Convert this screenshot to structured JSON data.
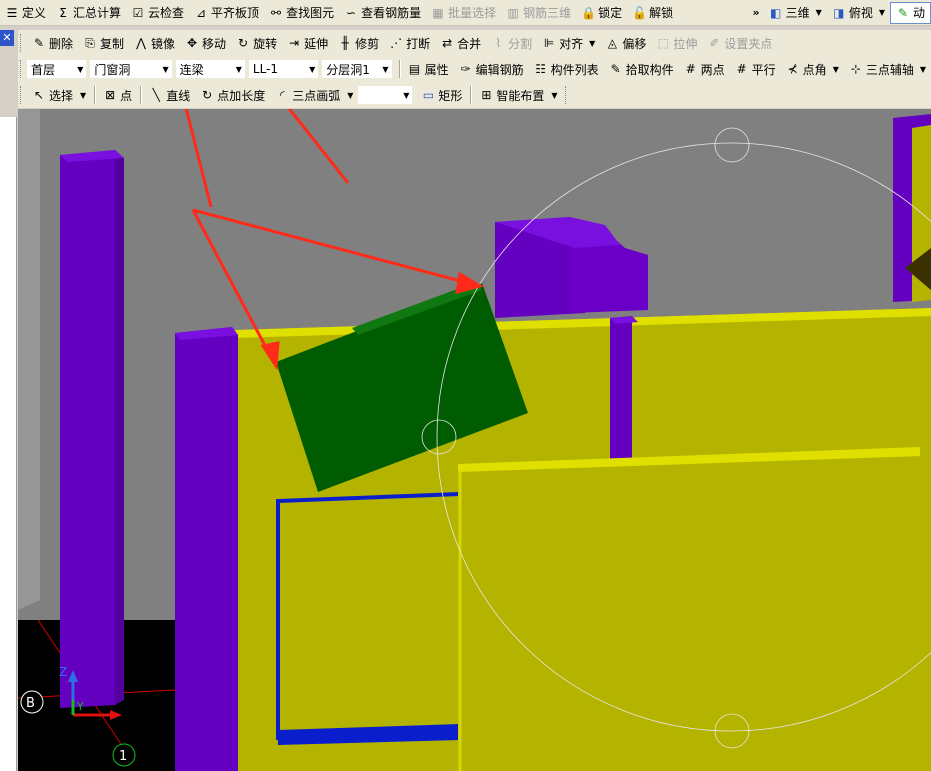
{
  "toolbar_main": {
    "items": [
      {
        "label": "定义",
        "icon": "define-icon"
      },
      {
        "label": "汇总计算",
        "icon": "sigma-icon"
      },
      {
        "label": "云检查",
        "icon": "cloud-check-icon"
      },
      {
        "label": "平齐板顶",
        "icon": "align-slab-icon"
      },
      {
        "label": "查找图元",
        "icon": "binoculars-icon"
      },
      {
        "label": "查看钢筋量",
        "icon": "rebar-qty-icon"
      },
      {
        "label": "批量选择",
        "icon": "batch-select-icon",
        "disabled": true
      },
      {
        "label": "钢筋三维",
        "icon": "rebar-3d-icon",
        "disabled": true
      },
      {
        "label": "锁定",
        "icon": "lock-icon"
      },
      {
        "label": "解锁",
        "icon": "unlock-icon"
      }
    ],
    "overflow": "»",
    "view_3d": "三维",
    "view_top": "俯视",
    "dynamic": "动"
  },
  "toolbar_edit": {
    "items": [
      {
        "label": "删除",
        "icon": "delete-icon"
      },
      {
        "label": "复制",
        "icon": "copy-icon"
      },
      {
        "label": "镜像",
        "icon": "mirror-icon"
      },
      {
        "label": "移动",
        "icon": "move-icon"
      },
      {
        "label": "旋转",
        "icon": "rotate-icon"
      },
      {
        "label": "延伸",
        "icon": "extend-icon"
      },
      {
        "label": "修剪",
        "icon": "trim-icon"
      },
      {
        "label": "打断",
        "icon": "break-icon"
      },
      {
        "label": "合并",
        "icon": "merge-icon"
      },
      {
        "label": "分割",
        "icon": "split-icon",
        "disabled": true
      },
      {
        "label": "对齐",
        "icon": "align-icon",
        "dropdown": true
      },
      {
        "label": "偏移",
        "icon": "offset-icon"
      },
      {
        "label": "拉伸",
        "icon": "stretch-icon",
        "disabled": true
      },
      {
        "label": "设置夹点",
        "icon": "grip-point-icon",
        "disabled": true
      }
    ]
  },
  "toolbar_props": {
    "floor": "首层",
    "category": "门窗洞",
    "type": "连梁",
    "element": "LL-1",
    "layer": "分层洞1",
    "items": [
      {
        "label": "属性",
        "icon": "properties-icon"
      },
      {
        "label": "编辑钢筋",
        "icon": "edit-rebar-icon"
      },
      {
        "label": "构件列表",
        "icon": "component-list-icon"
      },
      {
        "label": "拾取构件",
        "icon": "pick-component-icon"
      },
      {
        "label": "两点",
        "icon": "two-point-icon"
      },
      {
        "label": "平行",
        "icon": "parallel-icon"
      },
      {
        "label": "点角",
        "icon": "point-angle-icon",
        "dropdown": true
      },
      {
        "label": "三点辅轴",
        "icon": "three-point-axis-icon",
        "dropdown": true
      }
    ]
  },
  "toolbar_draw": {
    "select": "选择",
    "point": "点",
    "line": "直线",
    "point_length": "点加长度",
    "arc": "三点画弧",
    "arc_option": "",
    "rect": "矩形",
    "smart": "智能布置"
  },
  "viewport": {
    "axis_z": "Z",
    "axis_y": "Y",
    "grid_b": "B",
    "grid_1": "1",
    "colors": {
      "background": "#808080",
      "column": "#6a00c8",
      "wall": "#b8b800",
      "beam": "#006400",
      "annotation": "#ff2a1a",
      "opening": "#0a1ecc"
    }
  }
}
